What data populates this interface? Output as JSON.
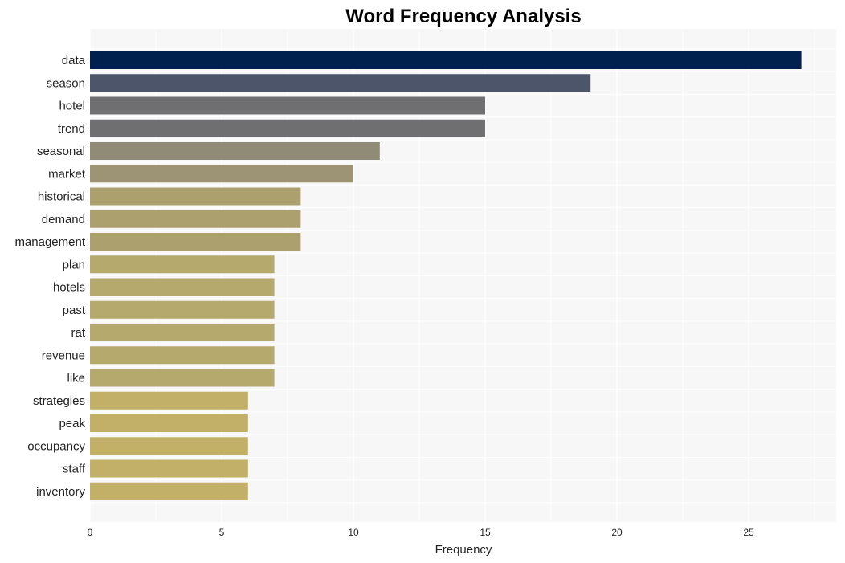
{
  "chart_data": {
    "type": "bar",
    "orientation": "horizontal",
    "title": "Word Frequency Analysis",
    "xlabel": "Frequency",
    "ylabel": "",
    "xlim": [
      0,
      28.3
    ],
    "xticks": [
      0,
      5,
      10,
      15,
      20,
      25
    ],
    "grid": true,
    "categories": [
      "data",
      "season",
      "hotel",
      "trend",
      "seasonal",
      "market",
      "historical",
      "demand",
      "management",
      "plan",
      "hotels",
      "past",
      "rat",
      "revenue",
      "like",
      "strategies",
      "peak",
      "occupancy",
      "staff",
      "inventory"
    ],
    "values": [
      27,
      19,
      15,
      15,
      11,
      10,
      8,
      8,
      8,
      7,
      7,
      7,
      7,
      7,
      7,
      6,
      6,
      6,
      6,
      6
    ],
    "colors": [
      "#00204e",
      "#4c556a",
      "#6f6f72",
      "#6f6f72",
      "#8f8b76",
      "#9c9475",
      "#ada06f",
      "#ada06f",
      "#ada06f",
      "#b6a96e",
      "#b6a96e",
      "#b6a96e",
      "#b6a96e",
      "#b6a96e",
      "#b6a96e",
      "#c3b068",
      "#c3b068",
      "#c3b068",
      "#c3b068",
      "#c3b068"
    ]
  }
}
